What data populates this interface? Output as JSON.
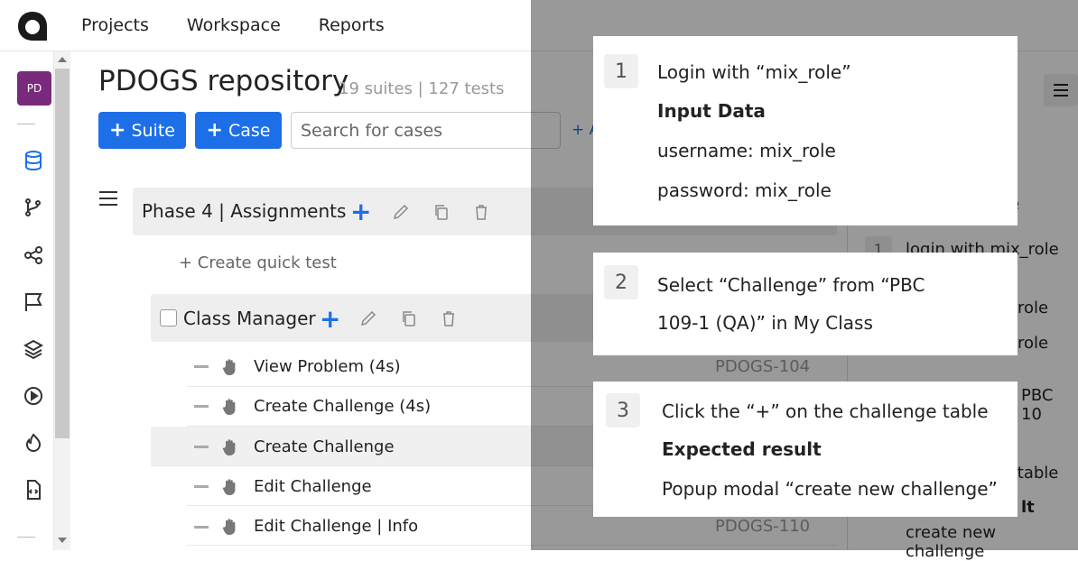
{
  "topnav": {
    "items": [
      "Projects",
      "Workspace",
      "Reports"
    ]
  },
  "sidebar": {
    "avatar": "PD"
  },
  "repo": {
    "title": "PDOGS repository",
    "meta": "19 suites | 127 tests"
  },
  "toolbar": {
    "suite_label": "Suite",
    "case_label": "Case",
    "search_placeholder": "Search for cases",
    "extra": "+ A"
  },
  "phase": {
    "title": "Phase 4 | Assignments"
  },
  "quick_test": "+ Create quick test",
  "class_manager": {
    "title": "Class Manager"
  },
  "cases": [
    {
      "title": "View Problem (4s)",
      "id": "PDOGS-104"
    },
    {
      "title": "Create Challenge (4s)",
      "id": ""
    },
    {
      "title": "Create Challenge",
      "id": ""
    },
    {
      "title": "Edit Challenge",
      "id": ""
    },
    {
      "title": "Edit Challenge | Info",
      "id": "PDOGS-110"
    }
  ],
  "right_panel": {
    "fragments": [
      "e",
      "login with mix_role",
      "_role",
      "_role",
      "PBC 10",
      "e table",
      "lt",
      "create new challenge"
    ],
    "step_num": "1"
  },
  "steps": [
    {
      "num": "1",
      "lines": [
        "Login with “mix_role”",
        "Input Data",
        "username: mix_role",
        "password: mix_role"
      ]
    },
    {
      "num": "2",
      "lines": [
        "Select “Challenge” from “PBC",
        "109-1 (QA)” in My Class"
      ]
    },
    {
      "num": "3",
      "lines": [
        "Click the “+” on the challenge table",
        "Expected result",
        "Popup modal “create new challenge”"
      ]
    }
  ],
  "colors": {
    "accent": "#1d6fe8",
    "avatar": "#7a2a7c"
  }
}
